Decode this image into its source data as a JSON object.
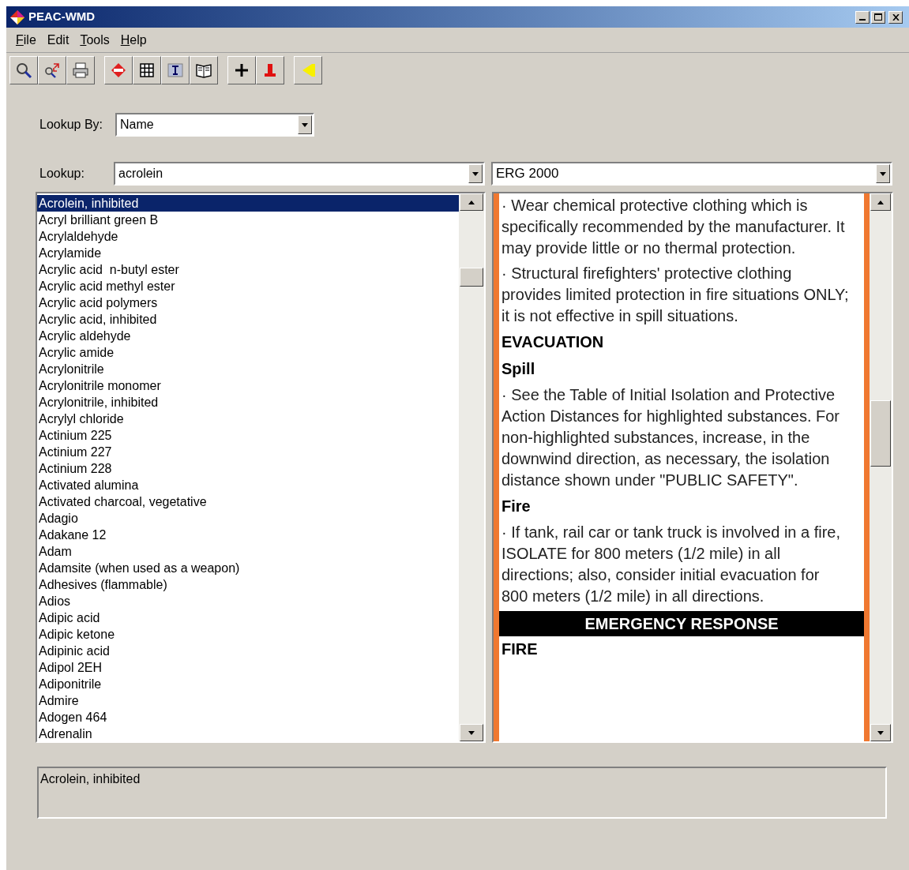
{
  "window": {
    "title": "PEAC-WMD"
  },
  "menu": [
    {
      "key": "F",
      "rest": "ile"
    },
    {
      "rest": "Edit"
    },
    {
      "key": "T",
      "rest": "ools"
    },
    {
      "key": "H",
      "rest": "elp"
    }
  ],
  "toolbar": [
    {
      "buttons": [
        {
          "kind": "search"
        },
        {
          "kind": "search-swap"
        },
        {
          "kind": "print"
        }
      ]
    },
    {
      "buttons": [
        {
          "kind": "diamond"
        },
        {
          "kind": "grid"
        },
        {
          "kind": "text"
        },
        {
          "kind": "book"
        }
      ]
    },
    {
      "buttons": [
        {
          "kind": "plus"
        },
        {
          "kind": "pin"
        }
      ]
    },
    {
      "buttons": [
        {
          "kind": "arrow"
        }
      ]
    }
  ],
  "lookup_by": {
    "label": "Lookup By:",
    "value": "Name"
  },
  "lookup": {
    "label": "Lookup:",
    "value": "acrolein"
  },
  "guide": {
    "value": "ERG 2000"
  },
  "results": [
    {
      "label": "Acrolein, inhibited",
      "selected": true
    },
    {
      "label": "Acryl brilliant green B",
      "selected": false
    },
    {
      "label": "Acrylaldehyde",
      "selected": false
    },
    {
      "label": "Acrylamide",
      "selected": false
    },
    {
      "label": "Acrylic acid  n-butyl ester",
      "selected": false
    },
    {
      "label": "Acrylic acid methyl ester",
      "selected": false
    },
    {
      "label": "Acrylic acid polymers",
      "selected": false
    },
    {
      "label": "Acrylic acid, inhibited",
      "selected": false
    },
    {
      "label": "Acrylic aldehyde",
      "selected": false
    },
    {
      "label": "Acrylic amide",
      "selected": false
    },
    {
      "label": "Acrylonitrile",
      "selected": false
    },
    {
      "label": "Acrylonitrile monomer",
      "selected": false
    },
    {
      "label": "Acrylonitrile, inhibited",
      "selected": false
    },
    {
      "label": "Acrylyl chloride",
      "selected": false
    },
    {
      "label": "Actinium 225",
      "selected": false
    },
    {
      "label": "Actinium 227",
      "selected": false
    },
    {
      "label": "Actinium 228",
      "selected": false
    },
    {
      "label": "Activated alumina",
      "selected": false
    },
    {
      "label": "Activated charcoal, vegetative",
      "selected": false
    },
    {
      "label": "Adagio",
      "selected": false
    },
    {
      "label": "Adakane 12",
      "selected": false
    },
    {
      "label": "Adam",
      "selected": false
    },
    {
      "label": "Adamsite (when used as a weapon)",
      "selected": false
    },
    {
      "label": "Adhesives (flammable)",
      "selected": false
    },
    {
      "label": "Adios",
      "selected": false
    },
    {
      "label": "Adipic acid",
      "selected": false
    },
    {
      "label": "Adipic ketone",
      "selected": false
    },
    {
      "label": "Adipinic acid",
      "selected": false
    },
    {
      "label": "Adipol 2EH",
      "selected": false
    },
    {
      "label": "Adiponitrile",
      "selected": false
    },
    {
      "label": "Admire",
      "selected": false
    },
    {
      "label": "Adogen 464",
      "selected": false
    },
    {
      "label": "Adrenalin",
      "selected": false
    }
  ],
  "document": [
    {
      "kind": "text",
      "text": "· Wear chemical protective clothing which is specifically recommended by the manufacturer. It may provide little or no thermal protection."
    },
    {
      "kind": "text",
      "text": "· Structural firefighters' protective clothing provides limited protection in fire situations ONLY; it is not effective in spill situations."
    },
    {
      "kind": "heading",
      "text": "EVACUATION"
    },
    {
      "kind": "heading",
      "text": "Spill"
    },
    {
      "kind": "text",
      "text": "· See the Table of Initial Isolation and Protective Action Distances for highlighted substances. For non-highlighted substances, increase, in the downwind direction, as necessary, the isolation distance shown under \"PUBLIC SAFETY\"."
    },
    {
      "kind": "heading",
      "text": "Fire"
    },
    {
      "kind": "text",
      "text": "· If tank, rail car or tank truck is involved in a fire, ISOLATE for 800 meters (1/2 mile) in all directions; also, consider initial evacuation for 800 meters (1/2 mile) in all directions."
    },
    {
      "kind": "banner",
      "text": "EMERGENCY RESPONSE"
    },
    {
      "kind": "heading",
      "text": "FIRE"
    }
  ],
  "status": {
    "text": "Acrolein, inhibited"
  }
}
